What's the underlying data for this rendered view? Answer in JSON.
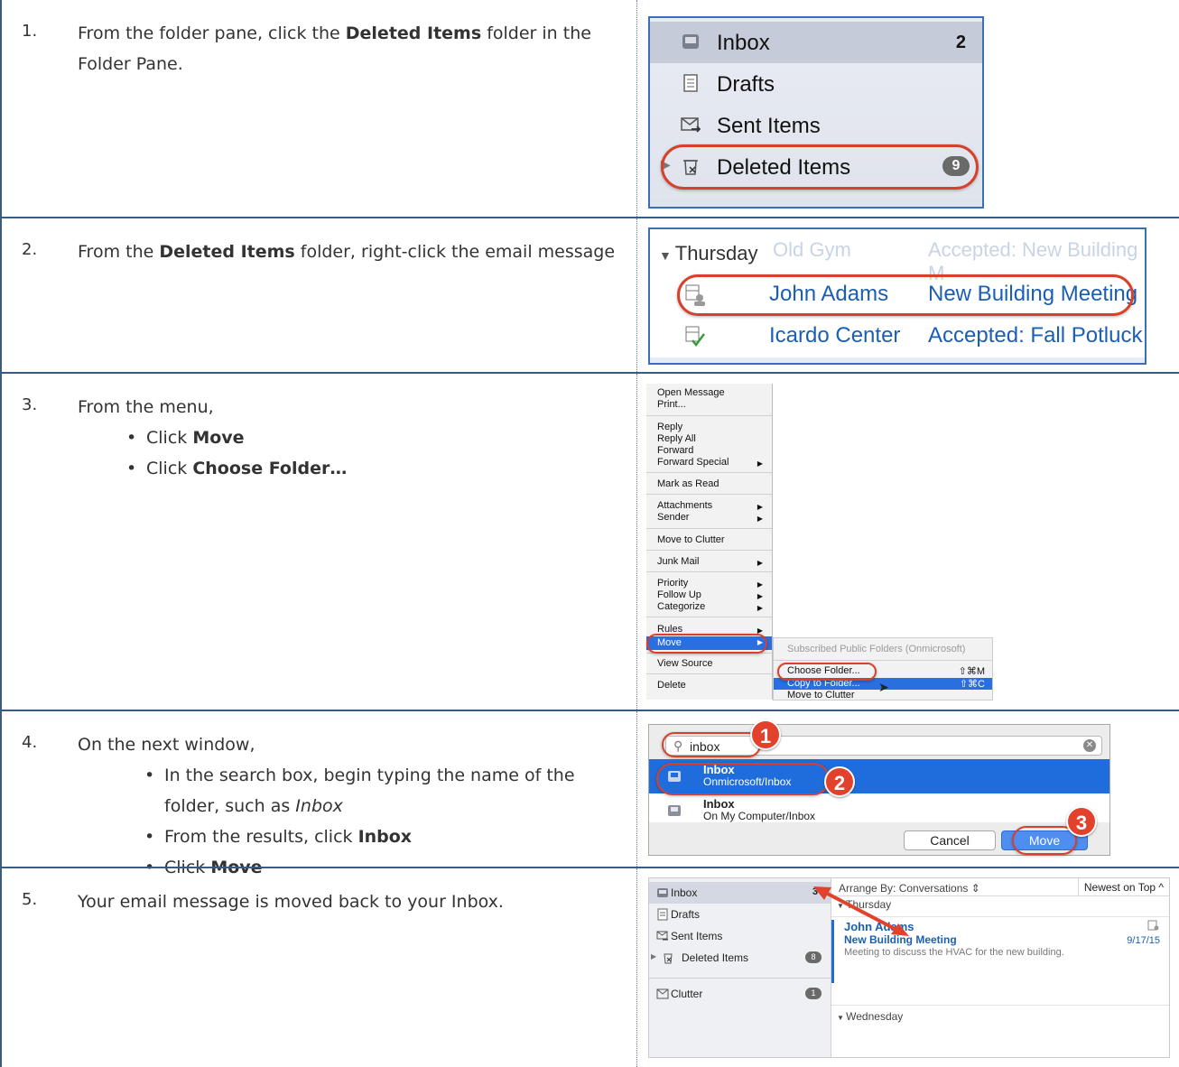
{
  "steps": [
    {
      "number": "1.",
      "text_parts": [
        "From the folder pane, click the ",
        "Deleted Items",
        " folder in the Folder Pane."
      ]
    },
    {
      "number": "2.",
      "text_parts": [
        "From the ",
        "Deleted Items",
        " folder, right-click the email message"
      ]
    },
    {
      "number": "3.",
      "intro": "From the menu,",
      "bullets": [
        {
          "prefix": "Click ",
          "bold": "Move"
        },
        {
          "prefix": "Click ",
          "bold": "Choose Folder…"
        }
      ]
    },
    {
      "number": "4.",
      "intro": "On the next window,",
      "bullets": [
        {
          "prefix": "In the search box, begin typing the name of the folder, such as ",
          "italic": "Inbox"
        },
        {
          "prefix": "From the results, click ",
          "bold": "Inbox"
        },
        {
          "prefix": "Click ",
          "bold": "Move"
        }
      ]
    },
    {
      "number": "5.",
      "text": "Your email message is moved back to your Inbox."
    }
  ],
  "shot1": {
    "folders": [
      {
        "label": "Inbox",
        "count": "2",
        "icon": "inbox-icon"
      },
      {
        "label": "Drafts",
        "icon": "drafts-icon"
      },
      {
        "label": "Sent Items",
        "icon": "sent-icon"
      },
      {
        "label": "Deleted Items",
        "count": "9",
        "icon": "trash-icon"
      }
    ]
  },
  "shot2": {
    "day": "Thursday",
    "ghost_sender": "Old Gym",
    "ghost_subject": "Accepted: New Building M",
    "rows": [
      {
        "sender": "John Adams",
        "subject": "New Building Meeting",
        "icon": "meeting-icon"
      },
      {
        "sender": "Icardo Center",
        "subject": "Accepted: Fall Potluck",
        "icon": "accepted-icon"
      }
    ]
  },
  "shot3": {
    "menu_items": [
      "Open Message",
      "Print...",
      "Reply",
      "Reply All",
      "Forward",
      "Forward Special",
      "Mark as Read",
      "Attachments",
      "Sender",
      "Move to Clutter",
      "Junk Mail",
      "Priority",
      "Follow Up",
      "Categorize",
      "Rules",
      "Move",
      "View Source",
      "Delete"
    ],
    "submenu_header": "Subscribed Public Folders (Onmicrosoft)",
    "submenu_items": [
      {
        "label": "Choose Folder...",
        "shortcut": "⇧⌘M"
      },
      {
        "label": "Copy to Folder...",
        "shortcut": "⇧⌘C"
      },
      {
        "label": "Move to Clutter",
        "shortcut": ""
      }
    ]
  },
  "shot4": {
    "search_value": "inbox",
    "results": [
      {
        "name": "Inbox",
        "path": "Onmicrosoft/Inbox"
      },
      {
        "name": "Inbox",
        "path": "On My Computer/Inbox"
      }
    ],
    "cancel_label": "Cancel",
    "move_label": "Move",
    "callouts": [
      "1",
      "2",
      "3"
    ]
  },
  "shot5": {
    "folders": [
      {
        "label": "Inbox",
        "count": "3"
      },
      {
        "label": "Drafts",
        "count": ""
      },
      {
        "label": "Sent Items",
        "count": ""
      },
      {
        "label": "Deleted Items",
        "count": "8"
      },
      {
        "label": "Clutter",
        "count": "1"
      }
    ],
    "arrange": "Arrange By: Conversations ⇕",
    "sort": "Newest on Top ^",
    "day1": "Thursday",
    "msg_sender": "John Adams",
    "msg_subject": "New Building Meeting",
    "msg_date": "9/17/15",
    "msg_preview": "Meeting to discuss the HVAC for the new building.",
    "day2": "Wednesday"
  }
}
